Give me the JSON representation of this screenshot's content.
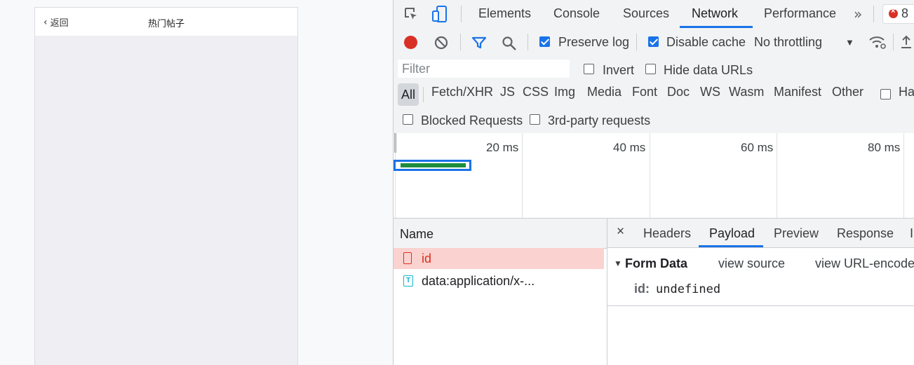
{
  "preview": {
    "back_label": "返回",
    "title": "热门帖子"
  },
  "devtools": {
    "tabs": [
      "Elements",
      "Console",
      "Sources",
      "Network",
      "Performance"
    ],
    "active_tab": "Network",
    "error_count": "8",
    "toolbar": {
      "preserve_log": "Preserve log",
      "disable_cache": "Disable cache",
      "throttling": "No throttling"
    },
    "filter": {
      "placeholder": "Filter",
      "invert": "Invert",
      "hide_data_urls": "Hide data URLs"
    },
    "types": [
      "All",
      "Fetch/XHR",
      "JS",
      "CSS",
      "Img",
      "Media",
      "Font",
      "Doc",
      "WS",
      "Wasm",
      "Manifest",
      "Other",
      "Ha"
    ],
    "blocked_requests": "Blocked Requests",
    "third_party": "3rd-party requests",
    "timeline_ticks": [
      "20 ms",
      "40 ms",
      "60 ms",
      "80 ms"
    ],
    "name_header": "Name",
    "requests": [
      {
        "name": "id",
        "status": "error"
      },
      {
        "name": "data:application/x-...",
        "status": "ok"
      }
    ],
    "detail_tabs": [
      "Headers",
      "Payload",
      "Preview",
      "Response",
      "I"
    ],
    "active_detail_tab": "Payload",
    "payload": {
      "section_title": "Form Data",
      "view_source": "view source",
      "view_url_encoded": "view URL-encoded",
      "field_key": "id:",
      "field_value": "undefined"
    }
  },
  "colors": {
    "accent": "#1a73e8",
    "record": "#d93025",
    "error_row": "#fad2cf",
    "error_text": "#d93025",
    "waterfall_bar": "#1e8e3e"
  }
}
